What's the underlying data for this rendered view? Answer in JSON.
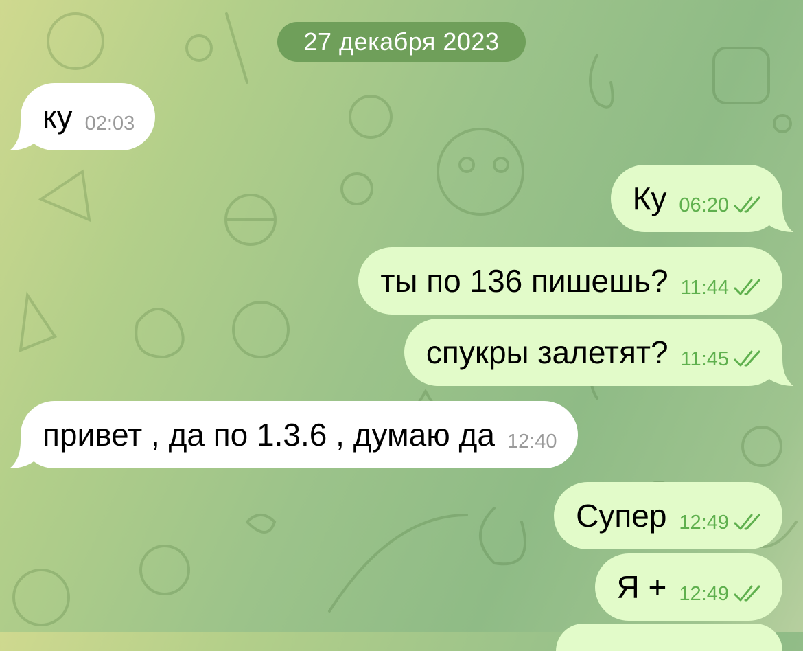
{
  "date_separator": "27 декабря 2023",
  "colors": {
    "incoming_bubble": "#ffffff",
    "outgoing_bubble": "#e2fbc9",
    "date_pill": "#6f9f5a",
    "outgoing_time": "#5fb04e",
    "incoming_time": "#9a9a9a"
  },
  "messages": [
    {
      "direction": "incoming",
      "text": "ку",
      "time": "02:03"
    },
    {
      "direction": "outgoing",
      "text": "Ку",
      "time": "06:20",
      "status_icon": "double-check-icon"
    },
    {
      "direction": "outgoing",
      "text": "ты по 136 пишешь?",
      "time": "11:44",
      "status_icon": "double-check-icon"
    },
    {
      "direction": "outgoing",
      "text": "спукры залетят?",
      "time": "11:45",
      "status_icon": "double-check-icon"
    },
    {
      "direction": "incoming",
      "text": "привет , да по 1.3.6 , думаю да",
      "time": "12:40"
    },
    {
      "direction": "outgoing",
      "text": "Супер",
      "time": "12:49",
      "status_icon": "double-check-icon"
    },
    {
      "direction": "outgoing",
      "text": "Я +",
      "time": "12:49",
      "status_icon": "double-check-icon"
    }
  ]
}
